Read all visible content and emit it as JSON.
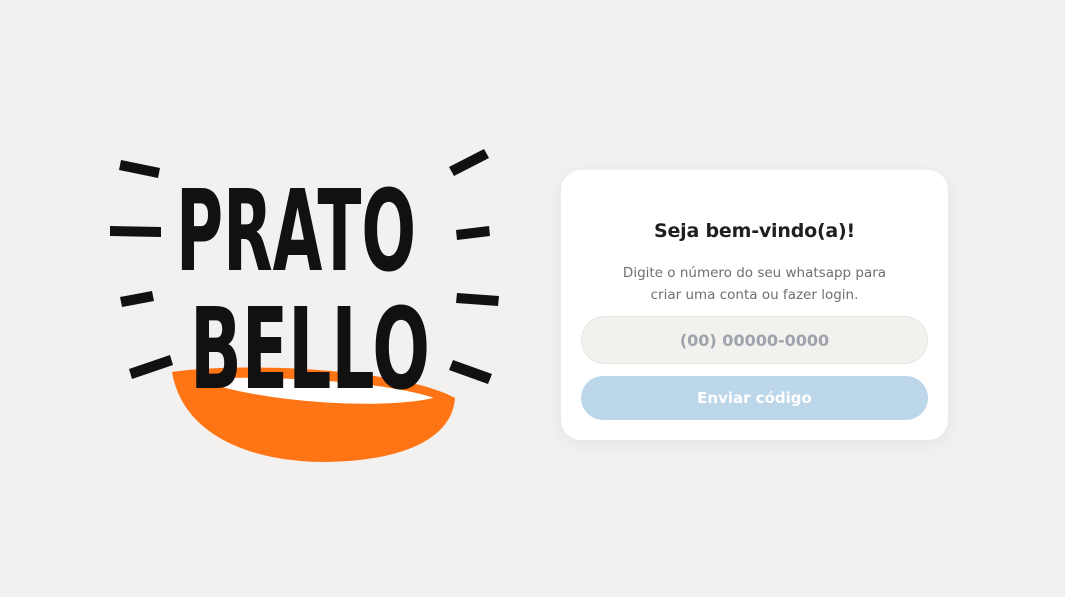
{
  "brand": {
    "logo_line1": "PRATO",
    "logo_line2": "BELLO",
    "logo_ink_color": "#111111",
    "logo_bowl_color": "#ff7415"
  },
  "login_card": {
    "title": "Seja bem-vindo(a)!",
    "subtitle_line1": "Digite o número do seu whatsapp para",
    "subtitle_line2": "criar uma conta ou fazer login.",
    "phone_input": {
      "placeholder": "(00) 00000-0000",
      "value": ""
    },
    "send_button_label": "Enviar código"
  },
  "colors": {
    "background": "#f3f1ef",
    "card": "#ffffff",
    "button_disabled": "#bcd6ea",
    "input_background": "#f3f1ee"
  }
}
